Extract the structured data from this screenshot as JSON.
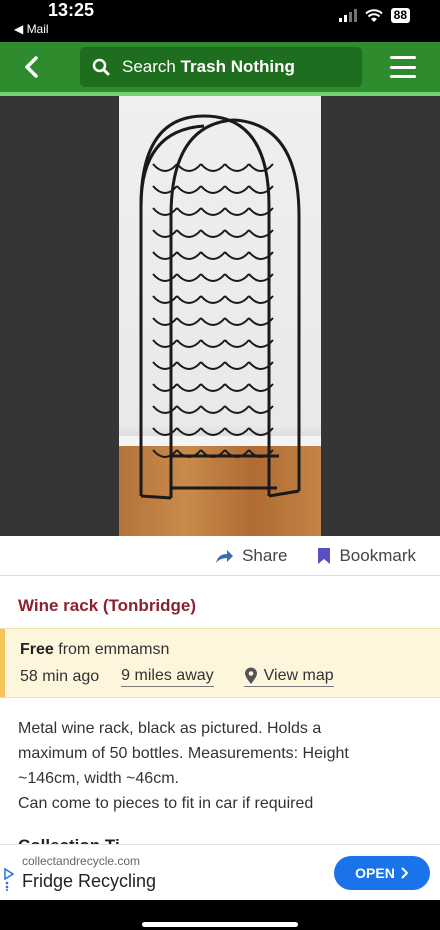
{
  "status_bar": {
    "time": "13:25",
    "back_app": "◀ Mail",
    "battery": "88"
  },
  "nav": {
    "search_prefix": "Search",
    "search_brand": "Trash Nothing"
  },
  "actions": {
    "share_label": "Share",
    "bookmark_label": "Bookmark"
  },
  "post": {
    "title": "Wine rack (Tonbridge)",
    "free_label": "Free",
    "from_text": " from emmamsn",
    "time_ago": "58 min ago",
    "distance": "9 miles away",
    "view_map": "View map",
    "description": [
      "Metal wine rack, black as pictured. Holds a",
      "maximum of 50 bottles. Measurements: Height",
      "~146cm, width ~46cm.",
      "Can come to pieces to fit in car if required"
    ],
    "next_heading": "Collection Ti"
  },
  "ad": {
    "domain": "collectandrecycle.com",
    "title": "Fridge Recycling",
    "open_label": "OPEN"
  },
  "colors": {
    "nav_green": "#2e8b2e",
    "title_red": "#8b2231",
    "info_bg": "#fdf5dc",
    "ad_blue": "#1a73e8"
  }
}
